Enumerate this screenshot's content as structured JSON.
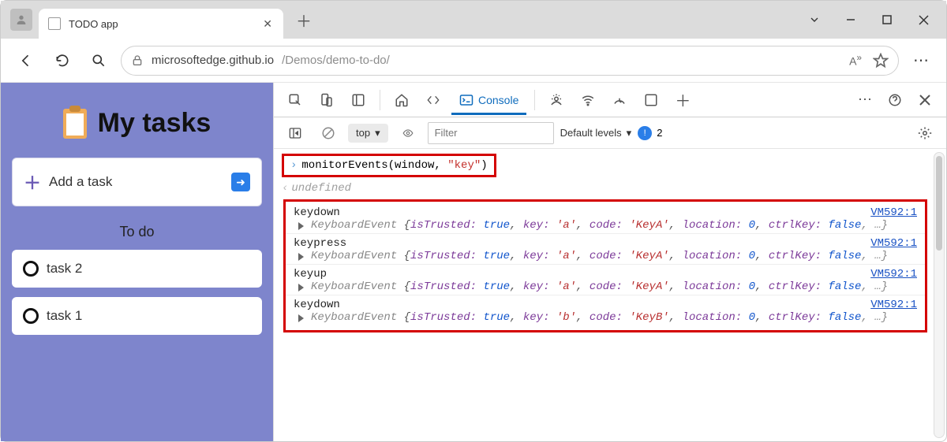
{
  "browser": {
    "tab_title": "TODO app",
    "url_host": "microsoftedge.github.io",
    "url_path": "/Demos/demo-to-do/"
  },
  "page": {
    "title": "My tasks",
    "add_label": "Add a task",
    "section": "To do",
    "tasks": [
      "task 2",
      "task 1"
    ]
  },
  "devtools": {
    "active_tab": "Console",
    "context": "top",
    "filter_placeholder": "Filter",
    "levels": "Default levels",
    "issue_count": "2",
    "command": {
      "fn": "monitorEvents",
      "args_plain": "(window, ",
      "args_str": "\"key\"",
      "args_close": ")"
    },
    "return_val": "undefined",
    "events": [
      {
        "name": "keydown",
        "link": "VM592:1",
        "key": "'a'",
        "code": "'KeyA'"
      },
      {
        "name": "keypress",
        "link": "VM592:1",
        "key": "'a'",
        "code": "'KeyA'"
      },
      {
        "name": "keyup",
        "link": "VM592:1",
        "key": "'a'",
        "code": "'KeyA'"
      },
      {
        "name": "keydown",
        "link": "VM592:1",
        "key": "'b'",
        "code": "'KeyB'"
      }
    ],
    "evt_tpl": {
      "class": "KeyboardEvent ",
      "open": "{",
      "isTrusted_k": "isTrusted: ",
      "isTrusted_v": "true",
      "key_k": "key: ",
      "code_k": "code: ",
      "location_k": "location: ",
      "location_v": "0",
      "ctrl_k": "ctrlKey: ",
      "ctrl_v": "false",
      "tail": ", …}",
      "comma": ", "
    }
  }
}
